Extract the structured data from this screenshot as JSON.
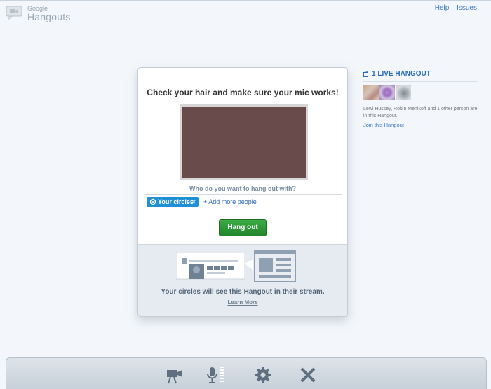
{
  "logo": {
    "small": "Google",
    "main": "Hangouts"
  },
  "header": {
    "links": [
      "Help",
      "Issues"
    ]
  },
  "card": {
    "title": "Check your hair and make sure your mic works!",
    "question": "Who do you want to hang out with?",
    "chip_label": "Your circles",
    "chip_close": "×",
    "add_more": "+ Add more people",
    "hangout_button": "Hang out",
    "stream_text": "Your circles will see this Hangout in their stream.",
    "learn_more": "Learn More"
  },
  "live_panel": {
    "title": "1 LIVE HANGOUT",
    "description": "Lewi Hussey, Robin Menikoff and 1 other person are in this Hangout.",
    "join_link": "Join this Hangout"
  },
  "toolbar": {
    "icons": [
      "camera-icon",
      "microphone-icon",
      "settings-icon",
      "close-icon"
    ]
  },
  "colors": {
    "accent_blue": "#2a6bb8",
    "chip_blue": "#1f8fd6",
    "button_green": "#2a9a35",
    "preview_bg": "#6a4b4b"
  }
}
